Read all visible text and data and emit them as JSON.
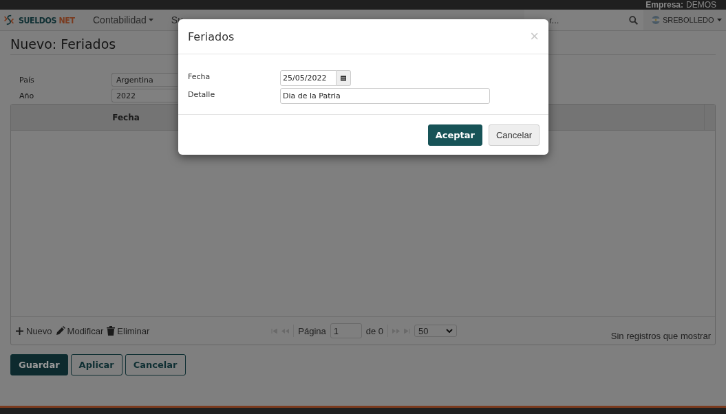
{
  "top_bar": {
    "company_label": "Empresa:",
    "company": "DEMOS"
  },
  "nav": {
    "logo": {
      "word1": "SUELDOS",
      "word2": "NET"
    },
    "menus": [
      {
        "label": "Contabilidad",
        "dropdown": true
      },
      {
        "label": "Su",
        "dropdown": false
      }
    ],
    "search": {
      "placeholder": "r..."
    },
    "user": "SREBOLLEDO"
  },
  "page": {
    "title": "Nuevo: Feriados",
    "fields": [
      {
        "label": "País",
        "value": "Argentina"
      },
      {
        "label": "Año",
        "value": "2022"
      }
    ],
    "table": {
      "columns": [
        "Fecha"
      ]
    },
    "toolbar": [
      {
        "kind": "add",
        "label": "Nuevo"
      },
      {
        "kind": "edit",
        "label": "Modificar"
      },
      {
        "kind": "delete",
        "label": "Eliminar"
      }
    ],
    "pager": {
      "page_label": "Página",
      "page": "1",
      "of": "de 0",
      "page_size": "50",
      "status": "Sin registros que mostrar"
    },
    "buttons": [
      {
        "label": "Guardar",
        "primary": true
      },
      {
        "label": "Aplicar",
        "primary": false
      },
      {
        "label": "Cancelar",
        "primary": false
      }
    ]
  },
  "dialog": {
    "title": "Feriados",
    "close": "×",
    "fields": [
      {
        "kind": "date",
        "label": "Fecha",
        "value": "25/05/2022"
      },
      {
        "kind": "text",
        "label": "Detalle",
        "value": "Dia de la Patria"
      }
    ],
    "buttons": [
      {
        "label": "Aceptar",
        "primary": true
      },
      {
        "label": "Cancelar",
        "primary": false
      }
    ]
  }
}
